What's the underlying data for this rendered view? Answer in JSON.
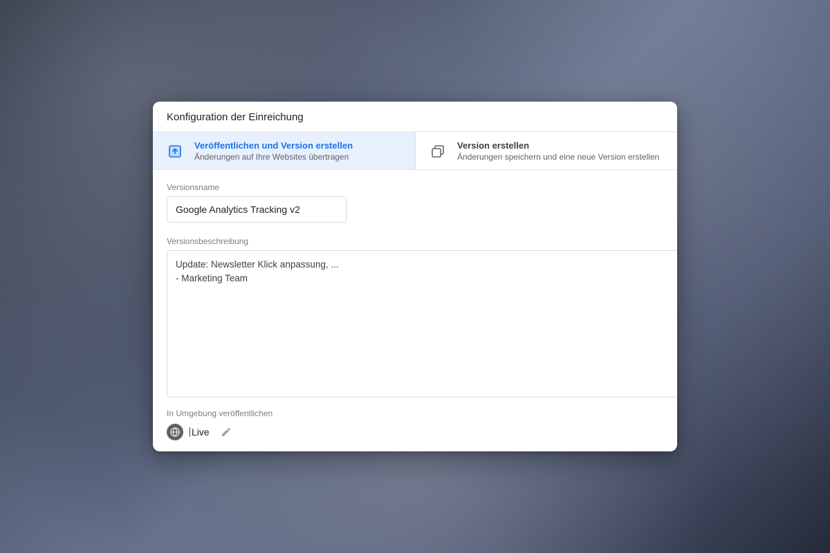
{
  "dialog": {
    "title": "Konfiguration der Einreichung"
  },
  "tabs": {
    "publish": {
      "title": "Veröffentlichen und Version erstellen",
      "subtitle": "Änderungen auf Ihre Websites übertragen"
    },
    "create": {
      "title": "Version erstellen",
      "subtitle": "Änderungen speichern und eine neue Version erstellen"
    }
  },
  "form": {
    "version_name_label": "Versionsname",
    "version_name_value": "Google Analytics Tracking v2",
    "version_desc_label": "Versionsbeschreibung",
    "version_desc_value": "Update: Newsletter Klick anpassung, ...\n- Marketing Team",
    "env_label": "In Umgebung veröffentlichen",
    "env_value": "Live"
  }
}
